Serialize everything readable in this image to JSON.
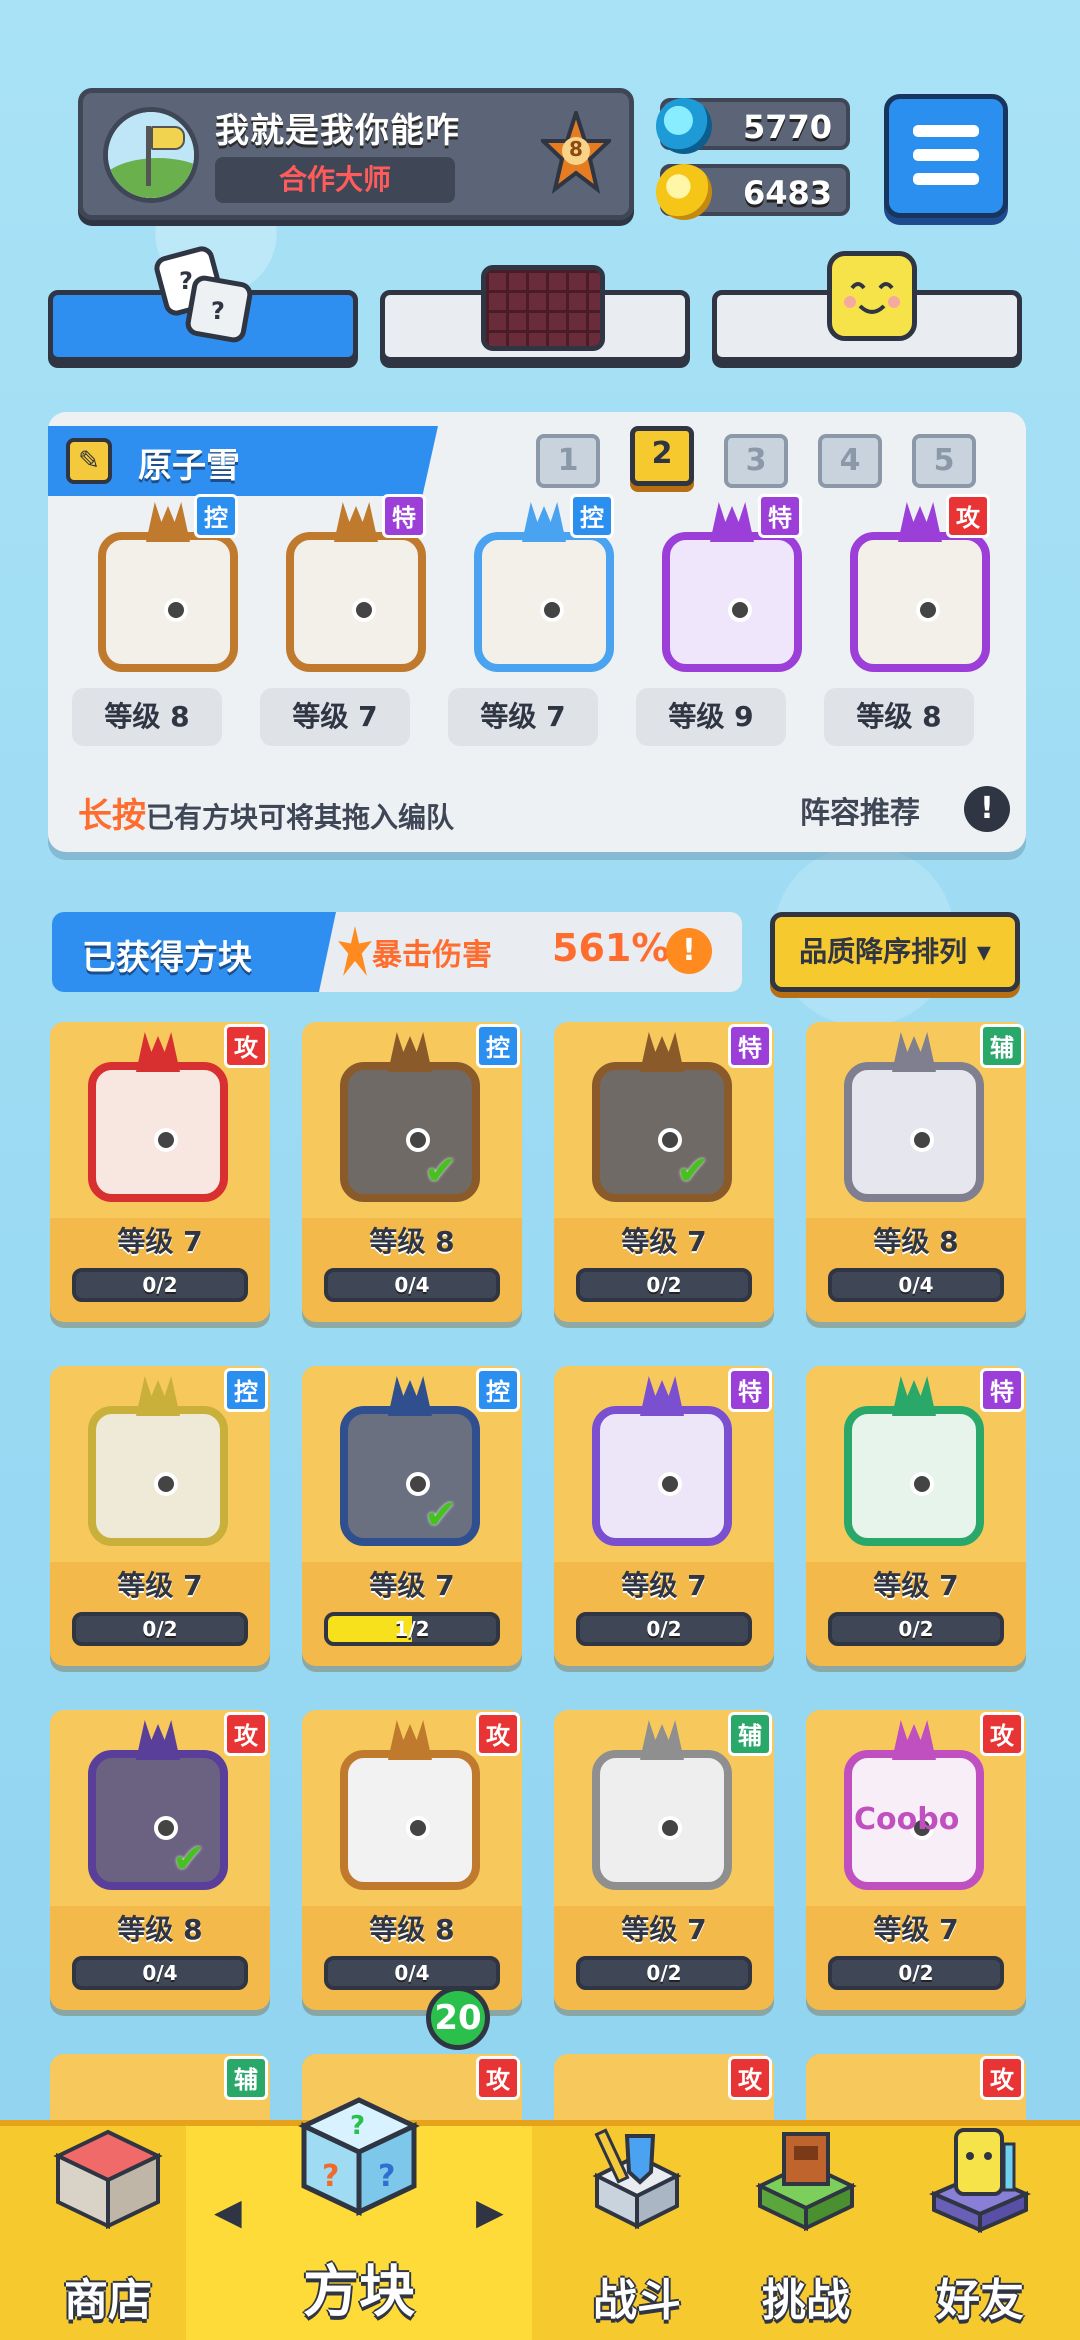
{
  "player": {
    "name": "我就是我你能咋",
    "title": "合作大师",
    "rank": "8"
  },
  "currency": {
    "gems": "5770",
    "coins": "6483"
  },
  "deck_tabs": [
    "dice-icon",
    "chocolate-icon",
    "smile-cube-icon"
  ],
  "formation": {
    "name": "原子雪",
    "pages": [
      "1",
      "2",
      "3",
      "4",
      "5"
    ],
    "active_page": "2",
    "slots": [
      {
        "tag": "控",
        "level": "等级 8"
      },
      {
        "tag": "特",
        "level": "等级 7"
      },
      {
        "tag": "控",
        "level": "等级 7"
      },
      {
        "tag": "特",
        "level": "等级 9"
      },
      {
        "tag": "攻",
        "level": "等级 8"
      }
    ],
    "hint_strong": "长按",
    "hint_rest": "已有方块可将其拖入编队",
    "recommend": "阵容推荐",
    "recommend_icon": "!"
  },
  "owned": {
    "title": "已获得方块",
    "crit_label": "暴击伤害",
    "crit_value": "561%",
    "crit_icon": "!",
    "sort_label": "品质降序排列 ▾"
  },
  "cards": [
    {
      "tag": "攻",
      "level": "等级 7",
      "progress": "0/2",
      "fill": 0,
      "checked": false
    },
    {
      "tag": "控",
      "level": "等级 8",
      "progress": "0/4",
      "fill": 0,
      "checked": true
    },
    {
      "tag": "特",
      "level": "等级 7",
      "progress": "0/2",
      "fill": 0,
      "checked": true
    },
    {
      "tag": "辅",
      "level": "等级 8",
      "progress": "0/4",
      "fill": 0,
      "checked": false
    },
    {
      "tag": "控",
      "level": "等级 7",
      "progress": "0/2",
      "fill": 0,
      "checked": false
    },
    {
      "tag": "控",
      "level": "等级 7",
      "progress": "1/2",
      "fill": 0.5,
      "checked": true
    },
    {
      "tag": "特",
      "level": "等级 7",
      "progress": "0/2",
      "fill": 0,
      "checked": false
    },
    {
      "tag": "特",
      "level": "等级 7",
      "progress": "0/2",
      "fill": 0,
      "checked": false
    },
    {
      "tag": "攻",
      "level": "等级 8",
      "progress": "0/4",
      "fill": 0,
      "checked": true
    },
    {
      "tag": "攻",
      "level": "等级 8",
      "progress": "0/4",
      "fill": 0,
      "checked": false
    },
    {
      "tag": "辅",
      "level": "等级 7",
      "progress": "0/2",
      "fill": 0,
      "checked": false
    },
    {
      "tag": "攻",
      "level": "等级 7",
      "progress": "0/2",
      "fill": 0,
      "checked": false,
      "art": "Coobo"
    }
  ],
  "partial_tags": [
    "辅",
    "攻",
    "攻",
    "攻"
  ],
  "nav": {
    "items": [
      "商店",
      "方块",
      "战斗",
      "挑战",
      "好友"
    ],
    "active": "方块",
    "badge": "20",
    "left_arrow": "◀",
    "right_arrow": "▶"
  },
  "colors": {
    "accent_blue": "#2f8ff0",
    "gold": "#f6c92f",
    "attack": "#e83434",
    "control": "#2b8ff0",
    "special": "#9b3fd8",
    "support": "#29a86a"
  }
}
